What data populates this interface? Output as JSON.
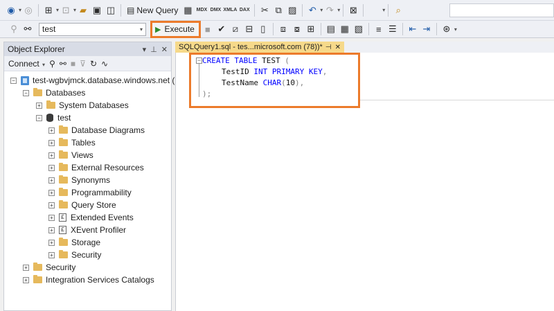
{
  "toolbar": {
    "new_query_label": "New Query",
    "mdx_label": "MDX",
    "dmx_label": "DMX",
    "xmla_label": "XMLA",
    "dax_label": "DAX",
    "database_combo": "test",
    "execute_label": "Execute"
  },
  "object_explorer": {
    "title": "Object Explorer",
    "connect_label": "Connect",
    "tree": [
      {
        "label": "test-wgbvjmck.database.windows.net (",
        "exp": "−",
        "icon": "server-icon"
      },
      {
        "label": "Databases",
        "exp": "−",
        "icon": "folder-icon"
      },
      {
        "label": "System Databases",
        "exp": "+",
        "icon": "folder-icon"
      },
      {
        "label": "test",
        "exp": "−",
        "icon": "database-icon"
      },
      {
        "label": "Database Diagrams",
        "exp": "+",
        "icon": "folder-icon"
      },
      {
        "label": "Tables",
        "exp": "+",
        "icon": "folder-icon"
      },
      {
        "label": "Views",
        "exp": "+",
        "icon": "folder-icon"
      },
      {
        "label": "External Resources",
        "exp": "+",
        "icon": "folder-icon"
      },
      {
        "label": "Synonyms",
        "exp": "+",
        "icon": "folder-icon"
      },
      {
        "label": "Programmability",
        "exp": "+",
        "icon": "folder-icon"
      },
      {
        "label": "Query Store",
        "exp": "+",
        "icon": "folder-icon"
      },
      {
        "label": "Extended Events",
        "exp": "+",
        "icon": "extended-events-icon"
      },
      {
        "label": "XEvent Profiler",
        "exp": "+",
        "icon": "xevent-profiler-icon"
      },
      {
        "label": "Storage",
        "exp": "+",
        "icon": "folder-icon"
      },
      {
        "label": "Security",
        "exp": "+",
        "icon": "folder-icon"
      },
      {
        "label": "Security",
        "exp": "+",
        "icon": "folder-icon"
      },
      {
        "label": "Integration Services Catalogs",
        "exp": "+",
        "icon": "folder-icon"
      }
    ]
  },
  "editor": {
    "tab_title": "SQLQuery1.sql - tes...microsoft.com (78))*",
    "line1_kw1": "CREATE TABLE",
    "line1_rest": " TEST ",
    "line1_paren": "(",
    "line2_name": "TestID ",
    "line2_kw": "INT PRIMARY KEY",
    "line2_comma": ",",
    "line3_name": "TestName ",
    "line3_kw": "CHAR",
    "line3_paren_open": "(",
    "line3_num": "10",
    "line3_paren_close": "),",
    "line4": ");"
  },
  "colors": {
    "highlight": "#ec7b2b",
    "keyword": "#0000ff",
    "tab_active": "#f6d98a"
  }
}
